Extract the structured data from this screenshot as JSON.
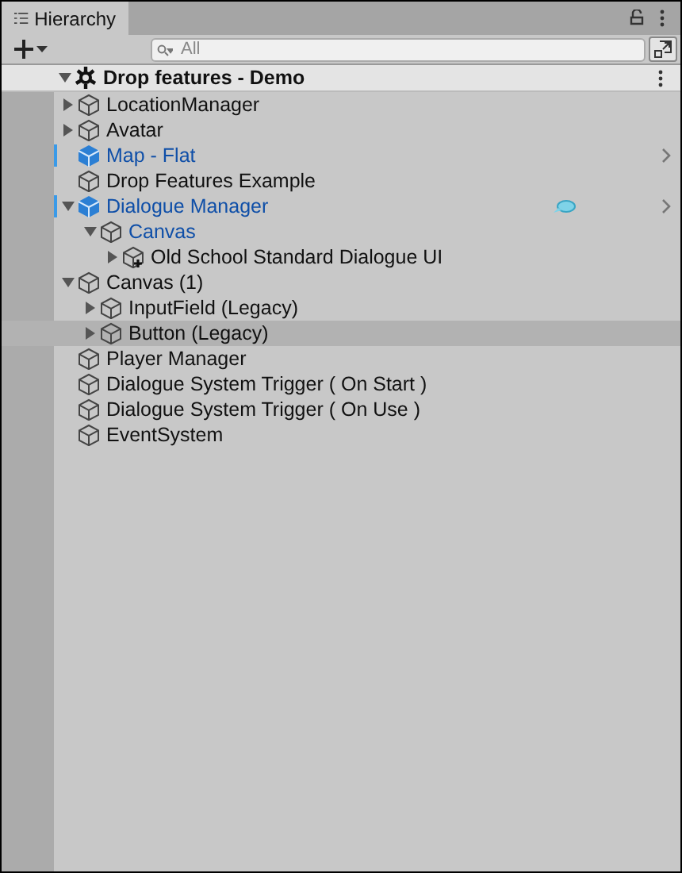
{
  "tab": {
    "title": "Hierarchy",
    "selected": true
  },
  "search": {
    "placeholder": "All"
  },
  "scene": {
    "name": "Drop features - Demo",
    "expanded": true,
    "children": [
      {
        "name": "LocationManager",
        "kind": "object",
        "expanded": false,
        "marked": false,
        "hovered": false
      },
      {
        "name": "Avatar",
        "kind": "object",
        "expanded": false,
        "marked": false,
        "hovered": false
      },
      {
        "name": "Map - Flat",
        "kind": "prefab_root",
        "marked": true,
        "hovered": false
      },
      {
        "name": "Drop Features Example",
        "kind": "object",
        "marked": false,
        "hovered": false
      },
      {
        "name": "Dialogue Manager",
        "kind": "prefab_root",
        "expanded": true,
        "marked": true,
        "hovered": false,
        "comment_icon": true,
        "children": [
          {
            "name": "Canvas",
            "kind": "prefab_child",
            "expanded": true,
            "marked": false,
            "hovered": false,
            "children": [
              {
                "name": "Old School Standard Dialogue UI",
                "kind": "added_prefab",
                "expanded": false,
                "marked": false,
                "hovered": false
              }
            ]
          }
        ]
      },
      {
        "name": "Canvas (1)",
        "kind": "object",
        "expanded": true,
        "marked": false,
        "hovered": false,
        "children": [
          {
            "name": "InputField (Legacy)",
            "kind": "object",
            "expanded": false,
            "marked": false,
            "hovered": false
          },
          {
            "name": "Button (Legacy)",
            "kind": "object",
            "expanded": false,
            "marked": false,
            "hovered": true
          }
        ]
      },
      {
        "name": "Player Manager",
        "kind": "object",
        "marked": false,
        "hovered": false
      },
      {
        "name": "Dialogue System Trigger ( On Start )",
        "kind": "object",
        "marked": false,
        "hovered": false
      },
      {
        "name": "Dialogue System Trigger ( On Use )",
        "kind": "object",
        "marked": false,
        "hovered": false
      },
      {
        "name": "EventSystem",
        "kind": "object",
        "marked": false,
        "hovered": false
      }
    ]
  }
}
